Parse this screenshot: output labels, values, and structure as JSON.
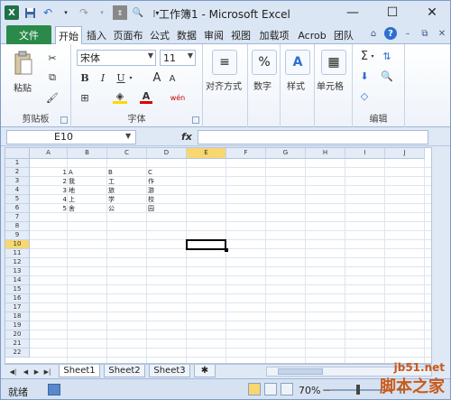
{
  "window": {
    "title": "工作簿1 - Microsoft Excel"
  },
  "tabs": [
    "开始",
    "插入",
    "页面布",
    "公式",
    "数据",
    "审阅",
    "视图",
    "加载项",
    "Acrob",
    "团队"
  ],
  "file_tab": "文件",
  "ribbon": {
    "paste_label": "粘贴",
    "clipboard_label": "剪贴板",
    "font_name": "宋体",
    "font_size": "11",
    "font_label": "字体",
    "align_label": "对齐方式",
    "number_label": "数字",
    "style_label": "样式",
    "cells_label": "单元格",
    "edit_label": "编辑",
    "bold": "B",
    "italic": "I",
    "underline": "U",
    "grow_font": "A",
    "shrink_font": "A",
    "percent": "%",
    "wen": "wén"
  },
  "formula_bar": {
    "name_box": "E10",
    "fx": "fx",
    "formula": ""
  },
  "columns": [
    "A",
    "B",
    "C",
    "D",
    "E",
    "F",
    "G",
    "H",
    "I",
    "J"
  ],
  "rows": [
    "1",
    "2",
    "3",
    "4",
    "5",
    "6",
    "7",
    "8",
    "9",
    "10",
    "11",
    "12",
    "13",
    "14",
    "15",
    "16",
    "17",
    "18",
    "19",
    "20",
    "21",
    "22"
  ],
  "selected": {
    "col": "E",
    "row": "10"
  },
  "cells": {
    "A2": "1",
    "A3": "2",
    "A4": "3",
    "A5": "4",
    "A6": "5",
    "B2": "A",
    "B3": "我",
    "B4": "地",
    "B5": "上",
    "B6": "舍",
    "C2": "B",
    "C3": "工",
    "C4": "旅",
    "C5": "学",
    "C6": "公",
    "D2": "C",
    "D3": "作",
    "D4": "游",
    "D5": "校",
    "D6": "园"
  },
  "sheet_tabs": [
    "Sheet1",
    "Sheet2",
    "Sheet3"
  ],
  "status": {
    "ready": "就绪",
    "zoom": "70%"
  },
  "watermark": {
    "site": "jb51.net",
    "name": "脚本之家"
  }
}
